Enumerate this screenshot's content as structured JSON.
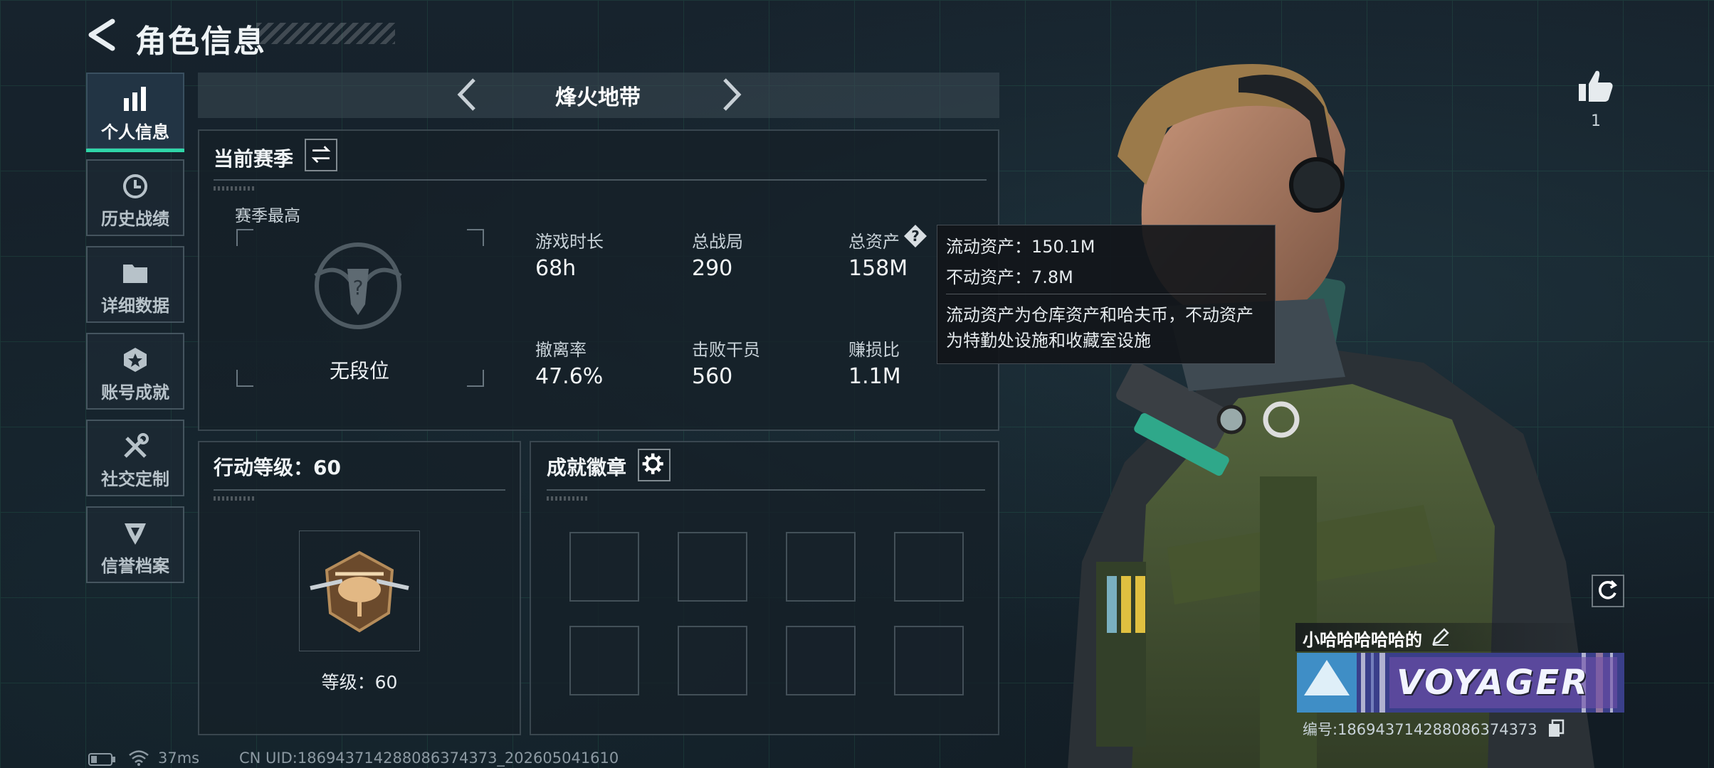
{
  "header": {
    "title": "角色信息"
  },
  "sidebar": {
    "items": [
      {
        "label": "个人信息",
        "icon": "bar-chart-icon",
        "active": true
      },
      {
        "label": "历史战绩",
        "icon": "history-clock-icon",
        "active": false
      },
      {
        "label": "详细数据",
        "icon": "folder-icon",
        "active": false
      },
      {
        "label": "账号成就",
        "icon": "achievement-star-icon",
        "active": false
      },
      {
        "label": "社交定制",
        "icon": "tools-icon",
        "active": false
      },
      {
        "label": "信誉档案",
        "icon": "credit-badge-icon",
        "active": false
      }
    ]
  },
  "mode_tabs": {
    "current": "烽火地带"
  },
  "season": {
    "title": "当前赛季",
    "best_label": "赛季最高",
    "rank_text": "无段位",
    "stats": [
      {
        "label": "游戏时长",
        "value": "68h"
      },
      {
        "label": "总战局",
        "value": "290"
      },
      {
        "label": "总资产",
        "value": "158M"
      },
      {
        "label": "撤离率",
        "value": "47.6%"
      },
      {
        "label": "击败干员",
        "value": "560"
      },
      {
        "label": "赚损比",
        "value": "1.1M"
      }
    ]
  },
  "tooltip": {
    "liquid": "流动资产：150.1M",
    "fixed": "不动资产：7.8M",
    "desc_line1": "流动资产为仓库资产和哈夫币，不动资产",
    "desc_line2": "为特勤处设施和收藏室设施"
  },
  "level": {
    "title": "行动等级：60",
    "badge_text": "等级：60"
  },
  "badges": {
    "title": "成就徽章",
    "slots": 8
  },
  "profile": {
    "likes": "1",
    "nickname": "小哈哈哈哈哈的",
    "banner_text": "VOYAGER",
    "id_text": "编号:1869437142880863743​73"
  },
  "footer": {
    "ping": "37ms",
    "uid": "CN UID:186943714288086374373_202605041610"
  },
  "colors": {
    "accent": "#2fd6a8",
    "background": "#15202a"
  }
}
